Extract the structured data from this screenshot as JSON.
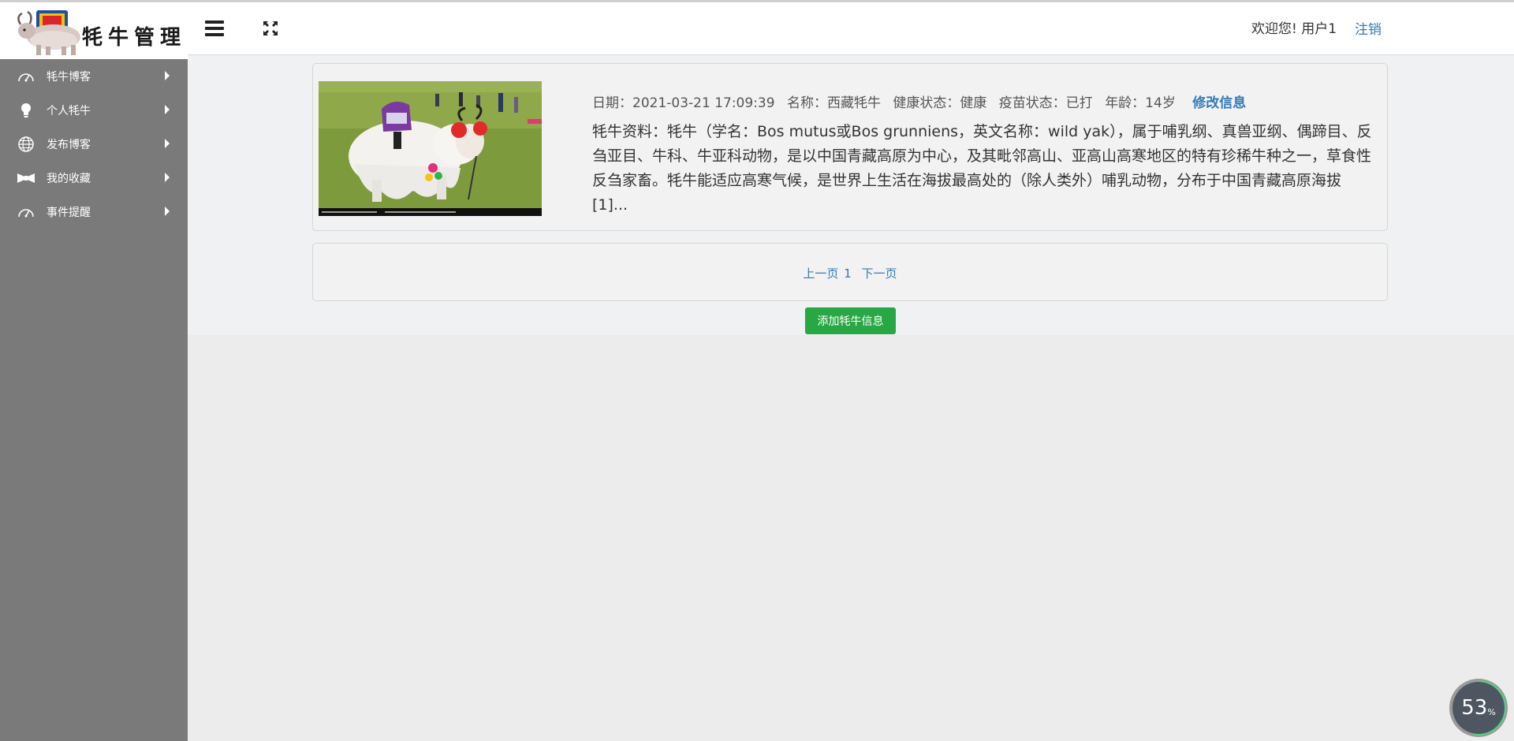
{
  "app": {
    "logo_text": "牦牛管理"
  },
  "sidebar": {
    "items": [
      {
        "label": "牦牛博客",
        "icon": "dashboard-icon"
      },
      {
        "label": "个人牦牛",
        "icon": "lightbulb-icon"
      },
      {
        "label": "发布博客",
        "icon": "globe-icon"
      },
      {
        "label": "我的收藏",
        "icon": "bowtie-icon"
      },
      {
        "label": "事件提醒",
        "icon": "dashboard-icon"
      }
    ]
  },
  "header": {
    "welcome": "欢迎您!  用户1",
    "logout": "注销",
    "menu_icon": "hamburger-icon",
    "fullscreen_icon": "fullscreen-icon"
  },
  "yak_card": {
    "date": "日期：2021-03-21 17:09:39",
    "name": "名称：西藏牦牛",
    "health": "健康状态：健康",
    "vaccine": "疫苗状态：已打",
    "age": "年龄：14岁",
    "edit_link": "修改信息",
    "description": "牦牛资料：牦牛（学名：Bos mutus或Bos grunniens，英文名称：wild yak），属于哺乳纲、真兽亚纲、偶蹄目、反刍亚目、牛科、牛亚科动物，是以中国青藏高原为中心，及其毗邻高山、亚高山高寒地区的特有珍稀牛种之一，草食性反刍家畜。牦牛能适应高寒气候，是世界上生活在海拔最高处的（除人类外）哺乳动物，分布于中国青藏高原海拔 [1]..."
  },
  "pagination": {
    "prev": "上一页",
    "current": "1",
    "next": "下一页"
  },
  "actions": {
    "add_label": "添加牦牛信息"
  },
  "progress_widget": {
    "value": "53",
    "unit": "%",
    "fraction": 0.53
  },
  "colors": {
    "sidebar_bg": "#7a7a7a",
    "link": "#337ab7",
    "add_button": "#28a745"
  }
}
